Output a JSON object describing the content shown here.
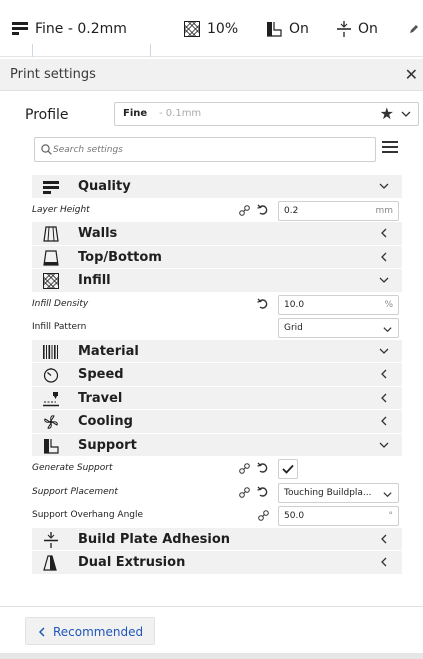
{
  "header": {
    "profile_summary": "Fine - 0.2mm",
    "infill": "10%",
    "support": "On",
    "adhesion": "On"
  },
  "panel": {
    "title": "Print settings",
    "close_glyph": "✕"
  },
  "profile": {
    "label": "Profile",
    "name": "Fine",
    "subtitle": "- 0.1mm"
  },
  "search": {
    "placeholder": "Search settings"
  },
  "settings": {
    "quality": {
      "label": "Quality",
      "icon": "quality-icon"
    },
    "layer_height": {
      "label": "Layer Height",
      "value": "0.2",
      "unit": "mm"
    },
    "walls": {
      "label": "Walls",
      "icon": "walls-icon"
    },
    "top_bottom": {
      "label": "Top/Bottom",
      "icon": "top-bottom-icon"
    },
    "infill": {
      "label": "Infill",
      "icon": "infill-icon"
    },
    "infill_density": {
      "label": "Infill Density",
      "value": "10.0",
      "unit": "%"
    },
    "infill_pattern": {
      "label": "Infill Pattern",
      "value": "Grid"
    },
    "material": {
      "label": "Material",
      "icon": "material-icon"
    },
    "speed": {
      "label": "Speed",
      "icon": "speed-icon"
    },
    "travel": {
      "label": "Travel",
      "icon": "travel-icon"
    },
    "cooling": {
      "label": "Cooling",
      "icon": "cooling-icon"
    },
    "support": {
      "label": "Support",
      "icon": "support-icon"
    },
    "generate_support": {
      "label": "Generate Support",
      "checked": true
    },
    "support_placement": {
      "label": "Support Placement",
      "value": "Touching Buildpla..."
    },
    "overhang_angle": {
      "label": "Support Overhang Angle",
      "value": "50.0",
      "unit": "°"
    },
    "build_plate_adhesion": {
      "label": "Build Plate Adhesion",
      "icon": "adhesion-icon"
    },
    "dual_extrusion": {
      "label": "Dual Extrusion",
      "icon": "dual-extrusion-icon"
    }
  },
  "footer": {
    "recommended_label": "Recommended"
  },
  "colors": {
    "accent": "#1f56b8",
    "category_bg": "#f1f1f1",
    "border": "#cfcfcf"
  }
}
